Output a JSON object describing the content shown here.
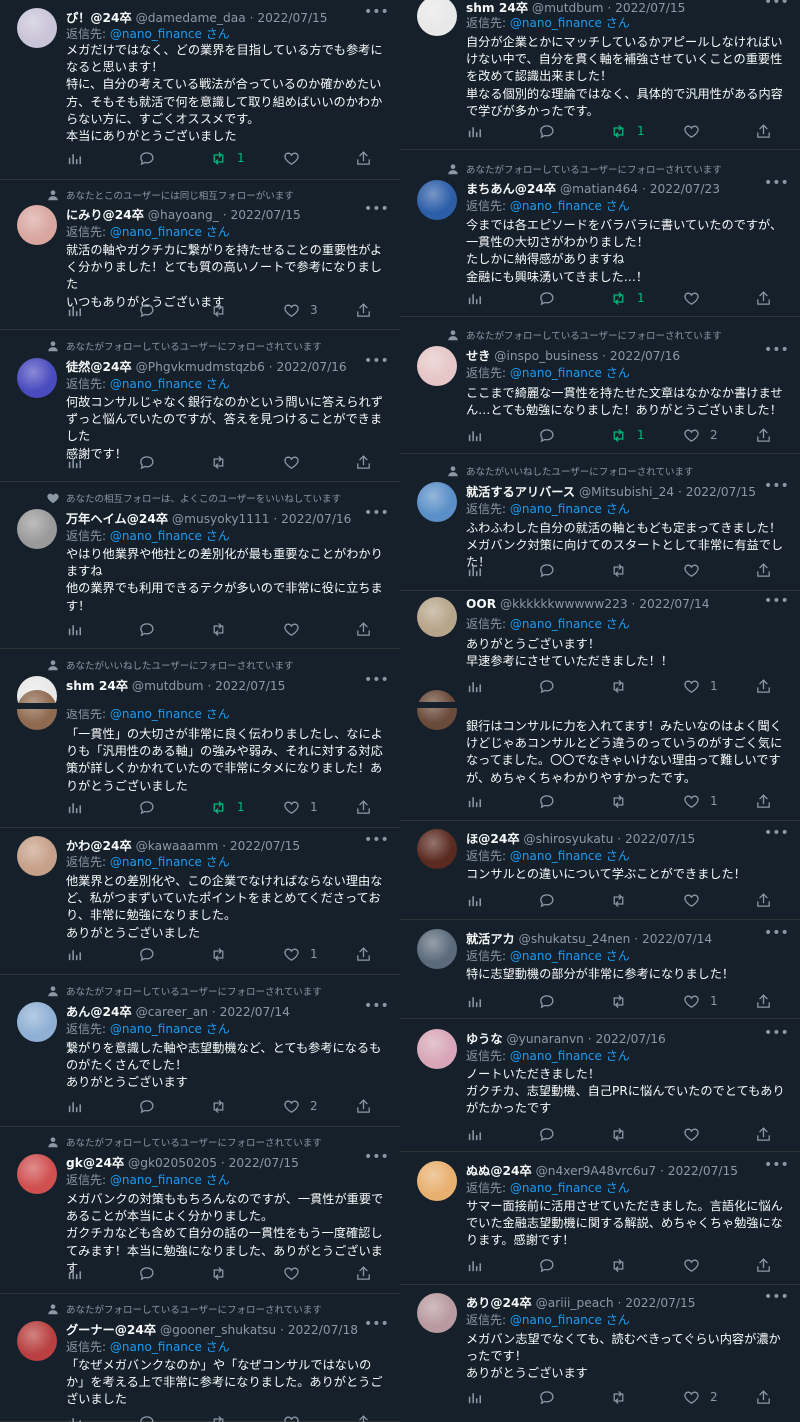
{
  "labels": {
    "reply_prefix": "返信先:",
    "more": "•••",
    "emoji": "☺"
  },
  "left": [
    {
      "name": "ぴ！@24卒",
      "handle": "@damedame_daa · 2022/07/15",
      "social": "",
      "reply_to": "@nano_finance さん",
      "text": "メガだけではなく、どの業界を目指している方でも参考になると思います！\n特に、自分の考えている戦法が合っているのか確かめたい方、そもそも就活で何を意識して取り組めばいいのかわからない方に、すごくオススメです。\n本当にありがとうございました",
      "counts": {
        "reply": "",
        "retweet": "1",
        "like": ""
      },
      "retweeted": true
    },
    {
      "name": "にみり@24卒",
      "handle": "@hayoang_ · 2022/07/15",
      "social": "あなたとこのユーザーには同じ相互フォローがいます",
      "reply_to": "@nano_finance さん",
      "text": "就活の軸やガクチカに繋がりを持たせることの重要性がよく分かりました！とても質の高いノートで参考になりました\nいつもありがとうございます",
      "counts": {
        "reply": "",
        "retweet": "",
        "like": "3"
      },
      "retweeted": false
    },
    {
      "name": "徒然@24卒",
      "handle": "@Phgvkmudmstqzb6 · 2022/07/16",
      "social": "あなたがフォローしているユーザーにフォローされています",
      "reply_to": "@nano_finance さん",
      "text": "何故コンサルじゃなく銀行なのかという問いに答えられずずっと悩んでいたのですが、答えを見つけることができました\n感謝です！",
      "counts": {
        "reply": "",
        "retweet": "",
        "like": ""
      },
      "retweeted": false
    },
    {
      "name": "万年ヘイム@24卒",
      "handle": "@musyoky1111 · 2022/07/16",
      "social": "あなたの相互フォローは、よくこのユーザーをいいねしています",
      "reply_to": "@nano_finance さん",
      "text": "やはり他業界や他社との差別化が最も重要なことがわかりますね\n他の業界でも利用できるテクが多いので非常に役に立ちます！",
      "counts": {
        "reply": "",
        "retweet": "",
        "like": ""
      },
      "retweeted": false
    },
    {
      "name": "shm 24卒",
      "handle": "@mutdbum · 2022/07/15",
      "social": "あなたがいいねしたユーザーにフォローされています",
      "reply_to": "",
      "text": "",
      "counts": {
        "reply": "",
        "retweet": "",
        "like": ""
      },
      "retweeted": false
    },
    {
      "name": "",
      "handle": "",
      "social": "",
      "reply_to": "@nano_finance さん",
      "text": "「一貫性」の大切さが非常に良く伝わりましたし、なによりも「汎用性のある軸」の強みや弱み、それに対する対応策が詳しくかかれていたので非常にタメになりました！ありがとうございました",
      "counts": {
        "reply": "",
        "retweet": "1",
        "like": "1"
      },
      "retweeted": true
    },
    {
      "name": "かわ@24卒",
      "handle": "@kawaaamm · 2022/07/15",
      "social": "",
      "reply_to": "@nano_finance さん",
      "text": "他業界との差別化や、この企業でなければならない理由など、私がつまずいていたポイントをまとめてくださっており、非常に勉強になりました。\nありがとうございました",
      "counts": {
        "reply": "",
        "retweet": "",
        "like": "1"
      },
      "retweeted": false
    },
    {
      "name": "あん@24卒",
      "handle": "@career_an · 2022/07/14",
      "social": "あなたがフォローしているユーザーにフォローされています",
      "reply_to": "@nano_finance さん",
      "text": "繋がりを意識した軸や志望動機など、とても参考になるものがたくさんでした！\nありがとうございます",
      "counts": {
        "reply": "",
        "retweet": "",
        "like": "2"
      },
      "retweeted": false
    },
    {
      "name": "gk@24卒",
      "handle": "@gk02050205 · 2022/07/15",
      "social": "あなたがフォローしているユーザーにフォローされています",
      "reply_to": "@nano_finance さん",
      "text": "メガバンクの対策ももちろんなのですが、一貫性が重要であることが本当によく分かりました。\nガクチカなども含めて自分の話の一貫性をもう一度確認してみます！本当に勉強になりました、ありがとうございます",
      "counts": {
        "reply": "",
        "retweet": "",
        "like": ""
      },
      "retweeted": false
    },
    {
      "name": "グーナー@24卒",
      "handle": "@gooner_shukatsu · 2022/07/18",
      "social": "あなたがフォローしているユーザーにフォローされています",
      "reply_to": "@nano_finance さん",
      "text": "「なぜメガバンクなのか」や「なぜコンサルではないのか」を考える上で非常に参考になりました。ありがとうございました",
      "counts": {
        "reply": "",
        "retweet": "",
        "like": ""
      },
      "retweeted": false
    }
  ],
  "right": [
    {
      "name": "shm 24卒",
      "handle": "@mutdbum · 2022/07/15",
      "social": "",
      "reply_to": "@nano_finance さん",
      "text": "自分が企業とかにマッチしているかアピールしなければいけない中で、自分を貫く軸を補強させていくことの重要性を改めて認識出来ました！\n単なる個別的な理論ではなく、具体的で汎用性がある内容で学びが多かったです。",
      "counts": {
        "reply": "",
        "retweet": "1",
        "like": ""
      },
      "retweeted": true
    },
    {
      "name": "まちあん@24卒",
      "handle": "@matian464 · 2022/07/23",
      "social": "あなたがフォローしているユーザーにフォローされています",
      "reply_to": "@nano_finance さん",
      "text": "今までは各エピソードをバラバラに書いていたのですが、一貫性の大切さがわかりました！\nたしかに納得感がありますね\n金融にも興味湧いてきました…！",
      "counts": {
        "reply": "",
        "retweet": "1",
        "like": ""
      },
      "retweeted": true
    },
    {
      "name": "せき",
      "handle": "@inspo_business · 2022/07/16",
      "social": "あなたがフォローしているユーザーにフォローされています",
      "reply_to": "@nano_finance さん",
      "text": "ここまで綺麗な一貫性を持たせた文章はなかなか書けません…とても勉強になりました！ありがとうございました！",
      "counts": {
        "reply": "",
        "retweet": "1",
        "like": "2"
      },
      "retweeted": true
    },
    {
      "name": "就活するアリバース",
      "handle": "@Mitsubishi_24 · 2022/07/15",
      "social": "あなたがいいねしたユーザーにフォローされています",
      "reply_to": "@nano_finance さん",
      "text": "ふわふわした自分の就活の軸ともども定まってきました！メガバンク対策に向けてのスタートとして非常に有益でした！",
      "counts": {
        "reply": "",
        "retweet": "",
        "like": ""
      },
      "retweeted": false
    },
    {
      "name": "OOR",
      "handle": "@kkkkkkwwwww223 · 2022/07/14",
      "social": "",
      "reply_to": "@nano_finance さん",
      "text": "ありがとうございます！\n早速参考にさせていただきました！！",
      "counts": {
        "reply": "",
        "retweet": "",
        "like": "1"
      },
      "retweeted": false
    },
    {
      "name": "",
      "handle": "",
      "social": "",
      "reply_to": "",
      "text": "銀行はコンサルに力を入れてます！みたいなのはよく聞くけどじゃあコンサルとどう違うのっていうのがすごく気になってました。〇〇でなきゃいけない理由って難しいですが、めちゃくちゃわかりやすかったです。",
      "counts": {
        "reply": "",
        "retweet": "",
        "like": "1"
      },
      "retweeted": false
    },
    {
      "name": "ほ@24卒",
      "handle": "@shirosyukatu · 2022/07/15",
      "social": "",
      "reply_to": "@nano_finance さん",
      "text": "コンサルとの違いについて学ぶことができました！",
      "counts": {
        "reply": "",
        "retweet": "",
        "like": ""
      },
      "retweeted": false
    },
    {
      "name": "就活アカ",
      "handle": "@shukatsu_24nen · 2022/07/14",
      "social": "",
      "reply_to": "@nano_finance さん",
      "text": "特に志望動機の部分が非常に参考になりました！",
      "counts": {
        "reply": "",
        "retweet": "",
        "like": "1"
      },
      "retweeted": false
    },
    {
      "name": "ゆうな",
      "handle": "@yunaranvn · 2022/07/16",
      "social": "",
      "reply_to": "@nano_finance さん",
      "text": "ノートいただきました！\nガクチカ、志望動機、自己PRに悩んでいたのでとてもありがたかったです",
      "counts": {
        "reply": "",
        "retweet": "",
        "like": ""
      },
      "retweeted": false
    },
    {
      "name": "ぬぬ@24卒",
      "handle": "@n4xer9A48vrc6u7 · 2022/07/15",
      "social": "",
      "reply_to": "@nano_finance さん",
      "text": "サマー面接前に活用させていただきました。言語化に悩んでいた金融志望動機に関する解説、めちゃくちゃ勉強になります。感謝です！",
      "counts": {
        "reply": "",
        "retweet": "",
        "like": ""
      },
      "retweeted": false
    },
    {
      "name": "あり@24卒",
      "handle": "@ariii_peach · 2022/07/15",
      "social": "",
      "reply_to": "@nano_finance さん",
      "text": "メガバン志望でなくても、読むべきってぐらい内容が濃かったです！\nありがとうございます",
      "counts": {
        "reply": "",
        "retweet": "",
        "like": "2"
      },
      "retweeted": false
    }
  ],
  "colors": {
    "bg": "#15202b",
    "text": "#f7f9f9",
    "muted": "#8b98a5",
    "link": "#1d9bf0",
    "retweet": "#00ba7c",
    "divider": "#2f3336"
  },
  "avatars_left": [
    "#c9c4d8",
    "#d9a6a0",
    "#4a4bbf",
    "#9a9a9a",
    "#e8e8e8",
    "#8f6a50",
    "#c7a089",
    "#8fb0d4",
    "#d05050",
    "#b84040"
  ],
  "avatars_right": [
    "#e8e8e8",
    "#2c5ea8",
    "#e6c6c6",
    "#5a8fc7",
    "#b7a58a",
    "#6a4a3a",
    "#5a2a20",
    "#5b6b7b",
    "#d8a6b8",
    "#e8b070",
    "#b89aa0"
  ],
  "icons": [
    "views-icon",
    "reply-icon",
    "retweet-icon",
    "like-icon",
    "share-icon",
    "more-icon",
    "person-icon",
    "heart-icon"
  ]
}
